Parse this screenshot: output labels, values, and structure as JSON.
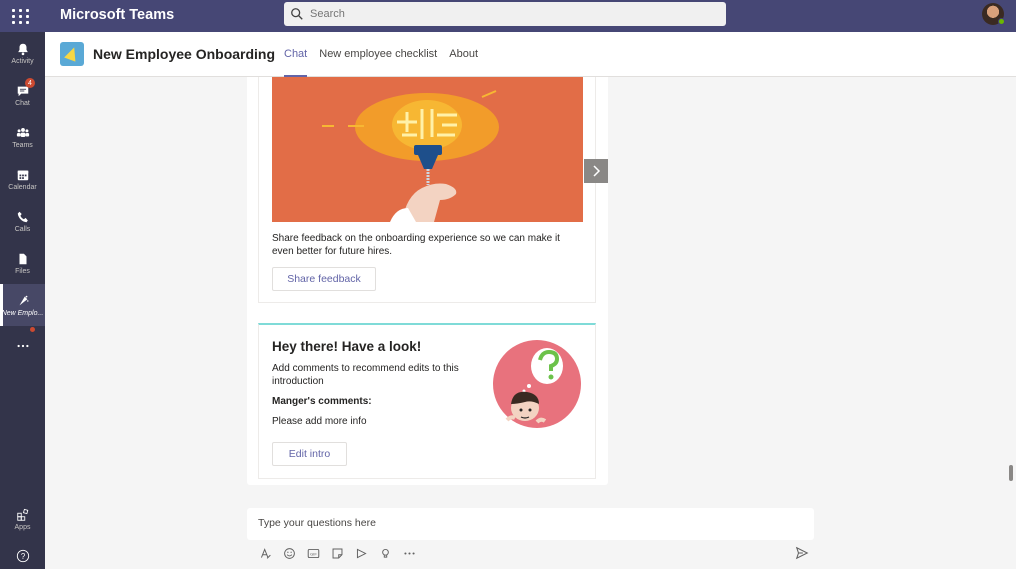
{
  "topbar": {
    "app_title": "Microsoft Teams",
    "search_placeholder": "Search"
  },
  "rail": {
    "items": [
      {
        "label": "Activity",
        "icon": "bell-icon"
      },
      {
        "label": "Chat",
        "icon": "chat-icon",
        "badge": "4"
      },
      {
        "label": "Teams",
        "icon": "teams-icon"
      },
      {
        "label": "Calendar",
        "icon": "calendar-icon"
      },
      {
        "label": "Calls",
        "icon": "phone-icon"
      },
      {
        "label": "Files",
        "icon": "file-icon"
      },
      {
        "label": "New Emplo...",
        "icon": "onboarding-app-icon"
      },
      {
        "label": "",
        "icon": "more-icon"
      },
      {
        "label": "Apps",
        "icon": "apps-icon"
      },
      {
        "label": "",
        "icon": "help-icon"
      }
    ]
  },
  "header": {
    "channel_title": "New Employee Onboarding",
    "tabs": [
      {
        "label": "Chat",
        "active": true
      },
      {
        "label": "New employee checklist",
        "active": false
      },
      {
        "label": "About",
        "active": false
      }
    ]
  },
  "feedback_card": {
    "text": "Share feedback on the onboarding experience so we can make it even better for future hires.",
    "button": "Share feedback"
  },
  "intro_card": {
    "title": "Hey there! Have a look!",
    "subtitle": "Add comments to recommend edits to this introduction",
    "comments_label": "Manger's comments:",
    "comments_value": "Please add more info",
    "button": "Edit intro"
  },
  "compose": {
    "placeholder": "Type your questions here"
  },
  "colors": {
    "accent": "#6264a7",
    "topbar": "#464775",
    "rail": "#33344a",
    "hero_bg": "#e26d47",
    "card_top_border": "#7fdbd8"
  }
}
